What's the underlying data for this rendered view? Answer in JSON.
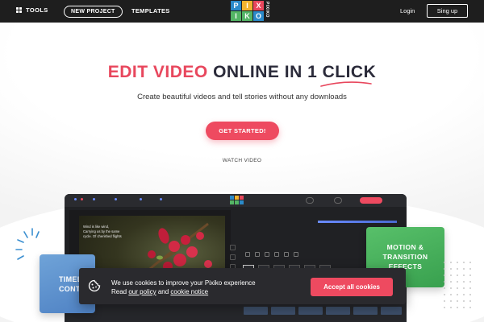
{
  "nav": {
    "tools_label": "TOOLS",
    "new_project_label": "NEW PROJECT",
    "templates_label": "TEMPLATES",
    "logo_letters": [
      "PI",
      "XI",
      "KO"
    ],
    "logo_tiles": [
      {
        "letter": "P",
        "color": "#2b8ac9"
      },
      {
        "letter": "I",
        "color": "#f1b42f"
      },
      {
        "letter": "X",
        "color": "#e8475d"
      },
      {
        "letter": "I",
        "color": "#53b565"
      },
      {
        "letter": "K",
        "color": "#53b565"
      },
      {
        "letter": "O",
        "color": "#2b8ac9"
      }
    ],
    "logo_word": "PIXIKO",
    "login_label": "Login",
    "signup_label": "Sing up"
  },
  "hero": {
    "headline_part1": "EDIT VIDEO",
    "headline_part2": "ONLINE IN 1",
    "headline_part3": "CLICK",
    "subtitle": "Create beautiful videos and tell stories without any downloads",
    "cta_label": "GET STARTED!",
    "watch_label": "WATCH VIDEO"
  },
  "editor": {
    "quote_lines": [
      "Wind is like wind,",
      "Carrying us by the same",
      "cycle. Of cherished flights"
    ],
    "tab_count": 6,
    "export_color": "#ee4a60"
  },
  "cards": {
    "left_line1": "TIMEL",
    "left_line2": "CONT",
    "right_line1": "MOTION &",
    "right_line2": "TRANSITION",
    "right_line3": "EFFECTS"
  },
  "cookie": {
    "line1": "We use cookies to improve your Pixiko experience",
    "line2_prefix": "Read ",
    "policy_link": "our policy",
    "line2_and": " and ",
    "notice_link": "cookie notice",
    "accept_label": "Accept all cookies"
  },
  "colors": {
    "accent": "#ee4a60",
    "nav_bg": "#1e1e1e",
    "card_blue": "#5f93cf",
    "card_green": "#49b05b"
  }
}
